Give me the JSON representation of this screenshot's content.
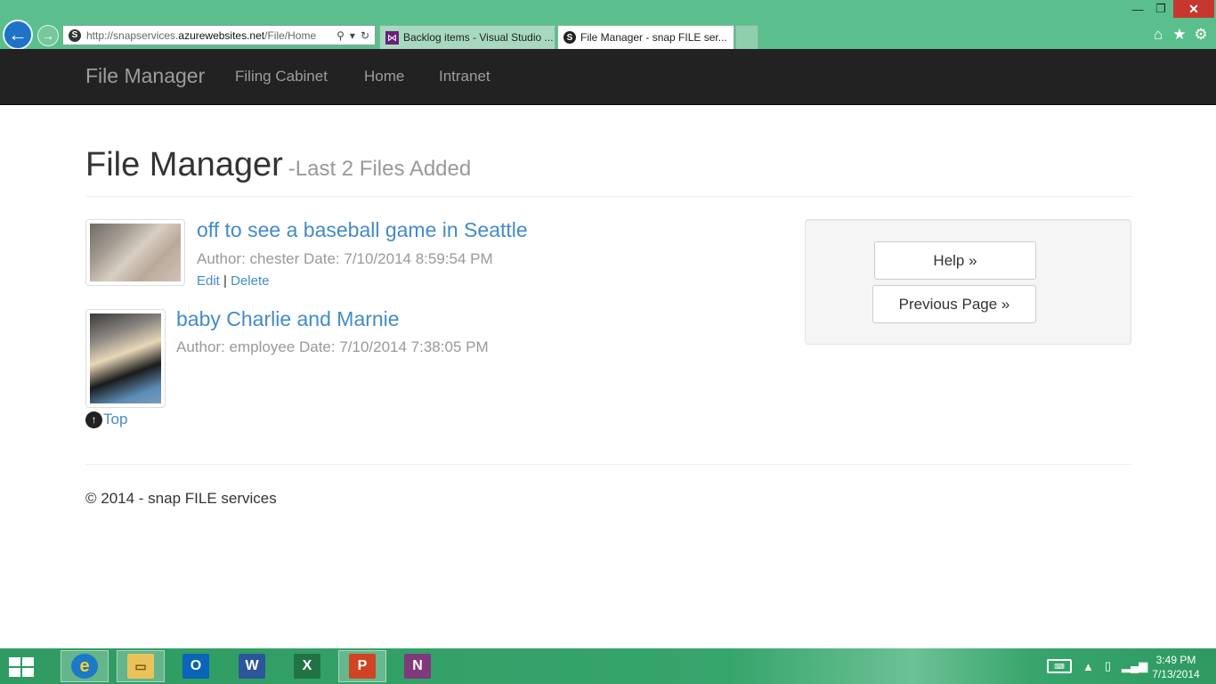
{
  "browser": {
    "url_prefix": "http://snapservices.",
    "url_domain": "azurewebsites.net",
    "url_path": "/File/Home",
    "site_icon": "S",
    "tabs": [
      {
        "label": "Backlog items - Visual Studio ...",
        "icon": "visual-studio-icon",
        "active": false
      },
      {
        "label": "File Manager - snap FILE ser...",
        "icon": "snap-site-icon",
        "active": true
      }
    ],
    "close_glyph": "✕"
  },
  "navbar": {
    "brand": "File Manager",
    "links": [
      "Filing Cabinet",
      "Home",
      "Intranet"
    ]
  },
  "header": {
    "title": "File Manager",
    "subtitle": "-Last 2 Files Added"
  },
  "files": [
    {
      "title": "off to see a baseball game in Seattle",
      "meta": "Author: chester Date: 7/10/2014 8:59:54 PM",
      "actions": {
        "edit": "Edit",
        "separator": "|",
        "delete": "Delete"
      }
    },
    {
      "title": "baby Charlie and Marnie",
      "meta": "Author: employee Date: 7/10/2014 7:38:05 PM"
    }
  ],
  "top_link": "Top",
  "side_panel": {
    "help": "Help »",
    "previous": "Previous Page »"
  },
  "footer": "© 2014 - snap FILE services",
  "taskbar": {
    "apps": [
      "internet-explorer",
      "file-explorer",
      "outlook",
      "word",
      "excel",
      "powerpoint",
      "onenote"
    ],
    "time": "3:49 PM",
    "date": "7/13/2014"
  },
  "colors": {
    "chrome_green": "#5abf8c",
    "navbar_bg": "#222222",
    "link_blue": "#428bca",
    "taskbar_green": "#36a56c"
  }
}
